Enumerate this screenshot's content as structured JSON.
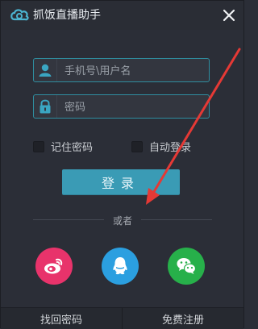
{
  "titlebar": {
    "title": "抓饭直播助手"
  },
  "login": {
    "username_placeholder": "手机号\\用户名",
    "password_placeholder": "密码",
    "remember_label": "记住密码",
    "auto_login_label": "自动登录",
    "submit_label": "登录"
  },
  "divider": {
    "text": "或者"
  },
  "social": {
    "weibo_icon": "weibo-icon",
    "qq_icon": "qq-icon",
    "wechat_icon": "wechat-icon"
  },
  "footer": {
    "find_password_label": "找回密码",
    "register_label": "免费注册"
  },
  "colors": {
    "background": "#2b2e37",
    "accent": "#3a9bb5",
    "field_border": "#2f8ea0",
    "weibo": "#e8336b",
    "qq": "#2b9fe0",
    "wechat": "#27b04a",
    "annotation_arrow": "#e53935"
  }
}
